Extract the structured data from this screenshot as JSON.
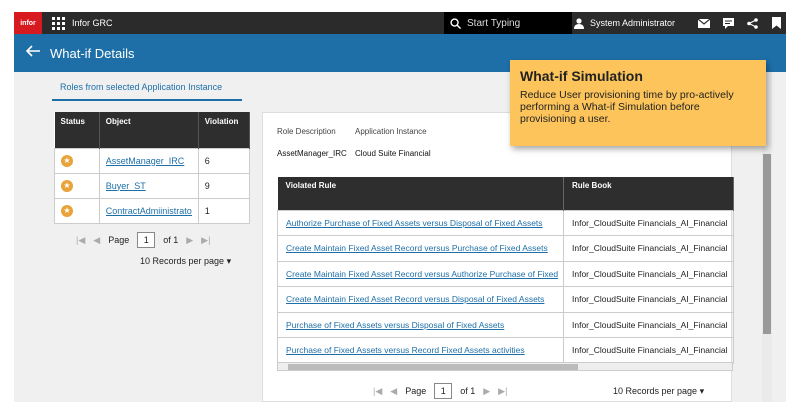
{
  "topbar": {
    "logo": "infor",
    "app_title": "Infor GRC",
    "search_placeholder": "Start Typing",
    "user": "System Administrator"
  },
  "titlebar": {
    "title": "What-if Details"
  },
  "tab": {
    "label": "Roles from selected Application Instance"
  },
  "roles_table": {
    "headers": [
      "Status",
      "Object",
      "Violation"
    ],
    "rows": [
      {
        "object": "AssetManager_IRC",
        "violation": "6"
      },
      {
        "object": "Buyer_ST",
        "violation": "9"
      },
      {
        "object": "ContractAdmiinistrator",
        "violation": "1"
      }
    ],
    "pager": {
      "page_label": "Page",
      "page": "1",
      "of_label": "of 1"
    },
    "records": "10 Records per page"
  },
  "detail": {
    "role_desc_label": "Role Description",
    "app_instance_label": "Application Instance",
    "role_desc_value": "AssetManager_IRC",
    "app_instance_value": "Cloud Suite Financial",
    "headers": [
      "Violated Rule",
      "Rule Book"
    ],
    "rows": [
      {
        "rule": "Authorize Purchase of Fixed Assets versus Disposal of Fixed Assets",
        "book": "Infor_CloudSuite Financials_AI_Financial"
      },
      {
        "rule": "Create Maintain Fixed Asset Record versus Purchase of Fixed Assets",
        "book": "Infor_CloudSuite Financials_AI_Financial"
      },
      {
        "rule": "Create Maintain Fixed Asset Record versus Authorize Purchase of Fixed",
        "book": "Infor_CloudSuite Financials_AI_Financial"
      },
      {
        "rule": "Create Maintain Fixed Asset Record versus Disposal of Fixed Assets",
        "book": "Infor_CloudSuite Financials_AI_Financial"
      },
      {
        "rule": "Purchase of Fixed Assets versus Disposal of Fixed Assets",
        "book": "Infor_CloudSuite Financials_AI_Financial"
      },
      {
        "rule": "Purchase of Fixed Assets versus Record Fixed Assets activities",
        "book": "Infor_CloudSuite Financials_AI_Financial"
      }
    ],
    "pager": {
      "page_label": "Page",
      "page": "1",
      "of_label": "of 1"
    },
    "records": "10 Records per page"
  },
  "callout": {
    "title": "What-if Simulation",
    "body": "Reduce User provisioning time by pro-actively performing a What-if Simulation before provisioning a user."
  },
  "colors": {
    "brand_red": "#d71920",
    "title_blue": "#1e6fa8",
    "callout_yellow": "#fcc45a",
    "status_orange": "#e8a33a"
  }
}
